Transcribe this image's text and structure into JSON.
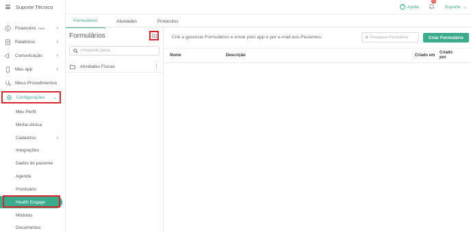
{
  "app": {
    "title": "Suporte Técnico"
  },
  "sidebar": {
    "items": [
      {
        "label": "Financeiro",
        "badge": "beta",
        "icon": "dollar-circle-icon"
      },
      {
        "label": "Relatórios",
        "icon": "report-icon"
      },
      {
        "label": "Comunicação",
        "icon": "megaphone-icon"
      },
      {
        "label": "Meu app",
        "icon": "phone-icon"
      },
      {
        "label": "Meus Procedimentos",
        "icon": "procedures-icon"
      },
      {
        "label": "Configurações",
        "icon": "gear-icon"
      }
    ],
    "sub_items": [
      "Meu Perfil",
      "Minha clínica",
      "Cadastros",
      "Integrações",
      "Dados do paciente",
      "Agenda",
      "Prontuário",
      "Health Engage",
      "Módulos",
      "Documentos"
    ]
  },
  "header": {
    "help_label": "Ajuda",
    "notification_count": "99",
    "user_label": "Suporte"
  },
  "tabs": [
    "Formulários",
    "Atividades",
    "Protocolos"
  ],
  "folders_panel": {
    "title": "Formulários",
    "search_placeholder": "Pesquisar pasta",
    "folders": [
      "Atividades Físicas"
    ]
  },
  "content": {
    "description": "Crie e gerencie Formulários e envie pelo app e por e-mail aos Pacientes.",
    "search_placeholder": "Pesquisar Formulário",
    "create_button": "Criar Formulário",
    "columns": [
      "Nome",
      "Descrição",
      "Criado em",
      "Criado por"
    ]
  },
  "colors": {
    "accent": "#3bab8e",
    "highlight": "#d9252a",
    "badge": "#e0453a"
  }
}
